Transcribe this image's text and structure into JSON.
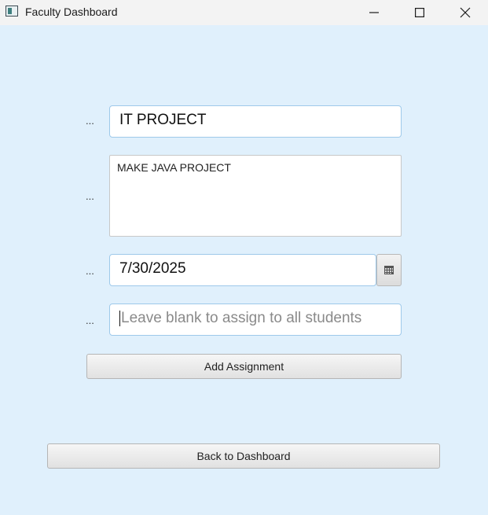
{
  "window": {
    "title": "Faculty Dashboard",
    "minimize_glyph": "—",
    "maximize_glyph": "☐",
    "close_glyph": "✕"
  },
  "form": {
    "title_label": "...",
    "title_value": "IT PROJECT",
    "description_label": "...",
    "description_value": "MAKE  JAVA PROJECT",
    "due_date_label": "...",
    "due_date_value": "7/30/2025",
    "student_label": "...",
    "student_placeholder": "Leave blank to assign to all students",
    "add_button_label": "Add Assignment"
  },
  "footer": {
    "back_button_label": "Back to Dashboard"
  },
  "colors": {
    "background": "#e0f0fc",
    "focus_border": "#9ec9ea"
  },
  "icons": {
    "calendar": "calendar-icon",
    "app": "app-window-icon"
  }
}
